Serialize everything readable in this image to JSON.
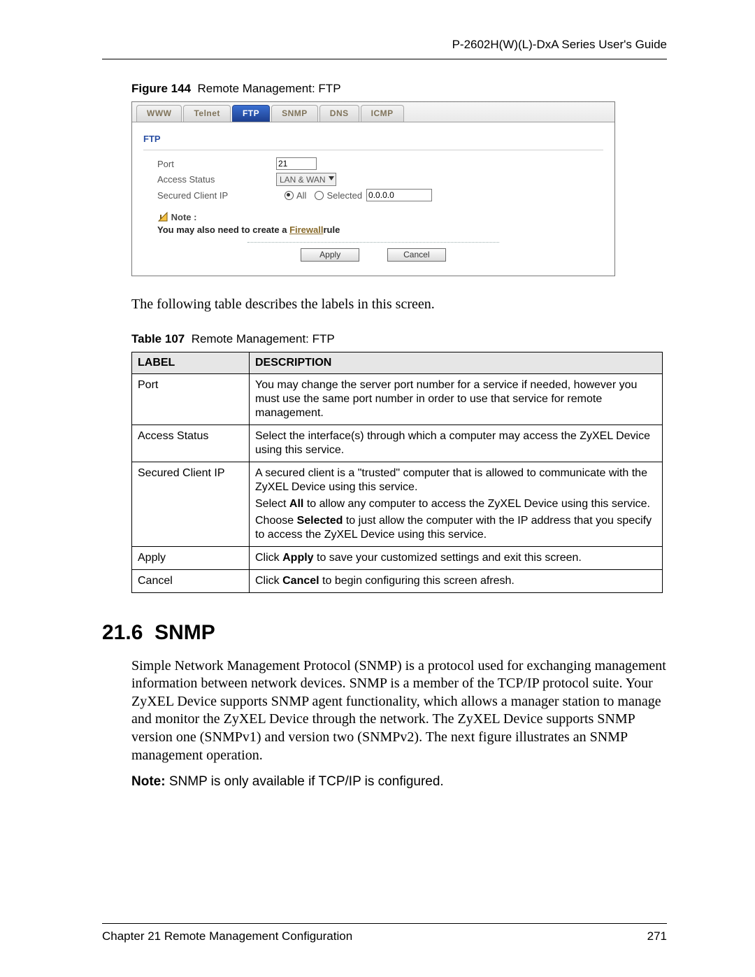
{
  "header": {
    "title": "P-2602H(W)(L)-DxA Series User's Guide"
  },
  "figure": {
    "label": "Figure 144",
    "title": "Remote Management: FTP"
  },
  "shot": {
    "tabs": [
      "WWW",
      "Telnet",
      "FTP",
      "SNMP",
      "DNS",
      "ICMP"
    ],
    "active_tab": "FTP",
    "section": "FTP",
    "rows": {
      "port": {
        "label": "Port",
        "value": "21"
      },
      "access": {
        "label": "Access Status",
        "value": "LAN & WAN"
      },
      "secured": {
        "label": "Secured Client IP",
        "opt_all": "All",
        "opt_selected": "Selected",
        "ip_value": "0.0.0.0"
      }
    },
    "note": {
      "label": "Note :",
      "msg_pre": "You may also need to create a ",
      "link": "Firewall",
      "msg_post": "rule"
    },
    "buttons": {
      "apply": "Apply",
      "cancel": "Cancel"
    }
  },
  "intro_text": "The following table describes the labels in this screen.",
  "table_caption": {
    "label": "Table 107",
    "title": "Remote Management: FTP"
  },
  "table": {
    "head": {
      "c0": "LABEL",
      "c1": "DESCRIPTION"
    },
    "rows": [
      {
        "label": "Port",
        "desc": "You may change the server port number for a service if needed, however you must use the same port number in order to use that service for remote management."
      },
      {
        "label": "Access Status",
        "desc": "Select the interface(s) through which a computer may access the ZyXEL Device using this service."
      },
      {
        "label": "Secured Client IP",
        "p1": "A secured client is a \"trusted\" computer that is allowed to communicate with the ZyXEL Device using this service.",
        "p2_pre": "Select ",
        "p2_b": "All",
        "p2_post": " to allow any computer to access the ZyXEL Device using this service.",
        "p3_pre": "Choose ",
        "p3_b": "Selected",
        "p3_post": " to just allow the computer with the IP address that you specify to access the ZyXEL Device using this service."
      },
      {
        "label": "Apply",
        "d_pre": "Click ",
        "d_b": "Apply",
        "d_post": " to save your customized settings and exit this screen."
      },
      {
        "label": "Cancel",
        "d_pre": "Click ",
        "d_b": "Cancel",
        "d_post": " to begin configuring this screen afresh."
      }
    ]
  },
  "section": {
    "number": "21.6",
    "title": "SNMP",
    "body": "Simple Network Management Protocol (SNMP) is a protocol used for exchanging management information between network devices. SNMP is a member of the TCP/IP protocol suite. Your ZyXEL Device supports SNMP agent functionality, which allows a manager station to manage and monitor the ZyXEL Device through the network. The ZyXEL Device supports SNMP version one (SNMPv1) and version two (SNMPv2). The next figure illustrates an SNMP management operation.",
    "note_b": "Note:",
    "note_rest": " SNMP is only available if TCP/IP is configured."
  },
  "footer": {
    "chapter": "Chapter 21 Remote Management Configuration",
    "page": "271"
  }
}
